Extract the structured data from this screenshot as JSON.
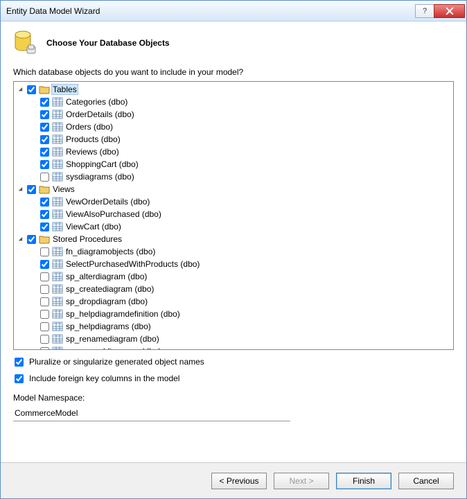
{
  "window": {
    "title": "Entity Data Model Wizard"
  },
  "header": {
    "title": "Choose Your Database Objects"
  },
  "prompt": "Which database objects do you want to include in your model?",
  "tree": {
    "tables": {
      "label": "Tables",
      "selected": true,
      "items": [
        {
          "label": "Categories (dbo)",
          "checked": true
        },
        {
          "label": "OrderDetails (dbo)",
          "checked": true
        },
        {
          "label": "Orders (dbo)",
          "checked": true
        },
        {
          "label": "Products (dbo)",
          "checked": true
        },
        {
          "label": "Reviews (dbo)",
          "checked": true
        },
        {
          "label": "ShoppingCart (dbo)",
          "checked": true
        },
        {
          "label": "sysdiagrams (dbo)",
          "checked": false
        }
      ]
    },
    "views": {
      "label": "Views",
      "items": [
        {
          "label": "VewOrderDetails (dbo)",
          "checked": true
        },
        {
          "label": "ViewAlsoPurchased (dbo)",
          "checked": true
        },
        {
          "label": "ViewCart (dbo)",
          "checked": true
        }
      ]
    },
    "procs": {
      "label": "Stored Procedures",
      "items": [
        {
          "label": "fn_diagramobjects (dbo)",
          "checked": false
        },
        {
          "label": "SelectPurchasedWithProducts (dbo)",
          "checked": true
        },
        {
          "label": "sp_alterdiagram (dbo)",
          "checked": false
        },
        {
          "label": "sp_creatediagram (dbo)",
          "checked": false
        },
        {
          "label": "sp_dropdiagram (dbo)",
          "checked": false
        },
        {
          "label": "sp_helpdiagramdefinition (dbo)",
          "checked": false
        },
        {
          "label": "sp_helpdiagrams (dbo)",
          "checked": false
        },
        {
          "label": "sp_renamediagram (dbo)",
          "checked": false
        },
        {
          "label": "sp_upgraddiagrams (dbo)",
          "checked": false
        }
      ]
    }
  },
  "options": {
    "pluralize": {
      "label": "Pluralize or singularize generated object names",
      "checked": true
    },
    "foreignkey": {
      "label": "Include foreign key columns in the model",
      "checked": true
    }
  },
  "namespace": {
    "label": "Model Namespace:",
    "value": "CommerceModel"
  },
  "buttons": {
    "previous": "< Previous",
    "next": "Next >",
    "finish": "Finish",
    "cancel": "Cancel"
  }
}
